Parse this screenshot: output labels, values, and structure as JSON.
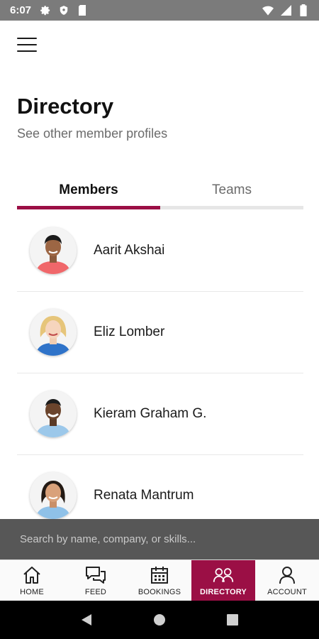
{
  "status_bar": {
    "time": "6:07",
    "left_icons": [
      "gear-icon",
      "shield-icon",
      "sd-card-icon"
    ],
    "right_icons": [
      "wifi-icon",
      "signal-icon",
      "battery-icon"
    ]
  },
  "header": {
    "menu_icon": "hamburger-menu-icon",
    "title": "Directory",
    "subtitle": "See other member profiles"
  },
  "tabs": [
    {
      "label": "Members",
      "active": true
    },
    {
      "label": "Teams",
      "active": false
    }
  ],
  "members": [
    {
      "name": "Aarit Akshai",
      "avatar": "person-avatar"
    },
    {
      "name": "Eliz Lomber",
      "avatar": "person-avatar"
    },
    {
      "name": "Kieram Graham G.",
      "avatar": "person-avatar"
    },
    {
      "name": "Renata Mantrum",
      "avatar": "person-avatar"
    }
  ],
  "search": {
    "placeholder": "Search by name, company, or skills..."
  },
  "bottom_nav": [
    {
      "label": "HOME",
      "icon": "home-icon",
      "active": false
    },
    {
      "label": "FEED",
      "icon": "chat-bubbles-icon",
      "active": false
    },
    {
      "label": "BOOKINGS",
      "icon": "calendar-icon",
      "active": false
    },
    {
      "label": "DIRECTORY",
      "icon": "people-icon",
      "active": true
    },
    {
      "label": "ACCOUNT",
      "icon": "person-icon",
      "active": false
    }
  ],
  "system_nav": [
    "back-icon",
    "home-circle-icon",
    "recents-icon"
  ],
  "colors": {
    "accent": "#9b0f45",
    "status_bar": "#7b7b7b",
    "search_bar": "#575757"
  }
}
